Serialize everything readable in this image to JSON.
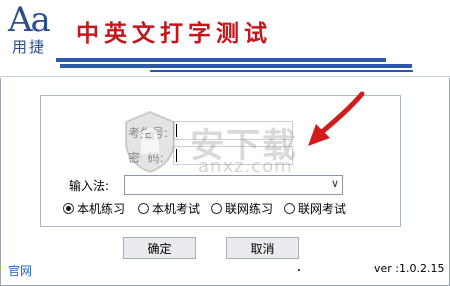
{
  "header": {
    "logo_main": "Aa",
    "logo_sub": "用捷",
    "title": "中英文打字测试"
  },
  "form": {
    "examinee_label": "考生号:",
    "password_label": "密  码:",
    "examinee_value": "",
    "password_value": "",
    "input_method_label": "输入法:",
    "input_method_value": ""
  },
  "modes": [
    {
      "label": "本机练习",
      "selected": true
    },
    {
      "label": "本机考试",
      "selected": false
    },
    {
      "label": "联网练习",
      "selected": false
    },
    {
      "label": "联网考试",
      "selected": false
    }
  ],
  "buttons": {
    "ok": "确定",
    "cancel": "取消"
  },
  "footer": {
    "official_link": "官网",
    "version": "ver :1.0.2.15"
  },
  "watermark": {
    "text": "安下载",
    "sub": "anxz.com"
  },
  "colors": {
    "title": "#c4171d",
    "accent": "#2c5aa8",
    "arrow": "#d21c1c",
    "link": "#2364c2"
  }
}
